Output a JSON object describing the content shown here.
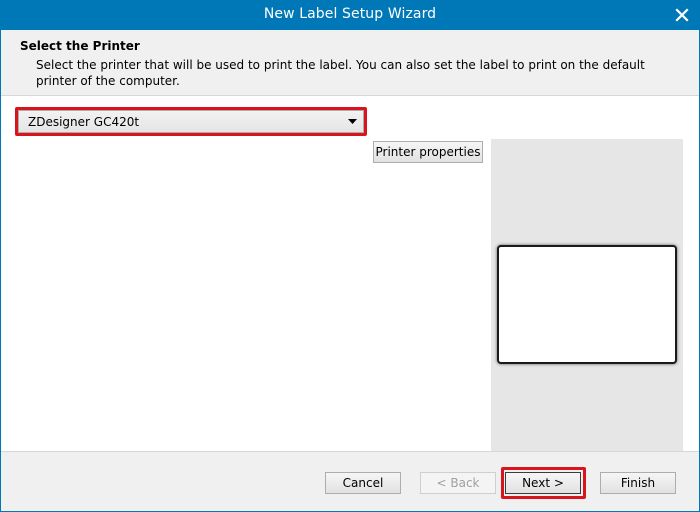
{
  "window": {
    "title": "New Label Setup Wizard",
    "accent_color": "#0078b8",
    "close_icon": "close-icon"
  },
  "header": {
    "title": "Select the Printer",
    "description": "Select the printer that will be used to print the label. You can also set the label to print on the default printer of the computer."
  },
  "printer": {
    "selected": "ZDesigner GC420t",
    "properties_label": "Printer properties"
  },
  "highlight_color": "#d9141c",
  "footer": {
    "cancel_label": "Cancel",
    "back_label": "< Back",
    "next_label": "Next >",
    "finish_label": "Finish"
  }
}
